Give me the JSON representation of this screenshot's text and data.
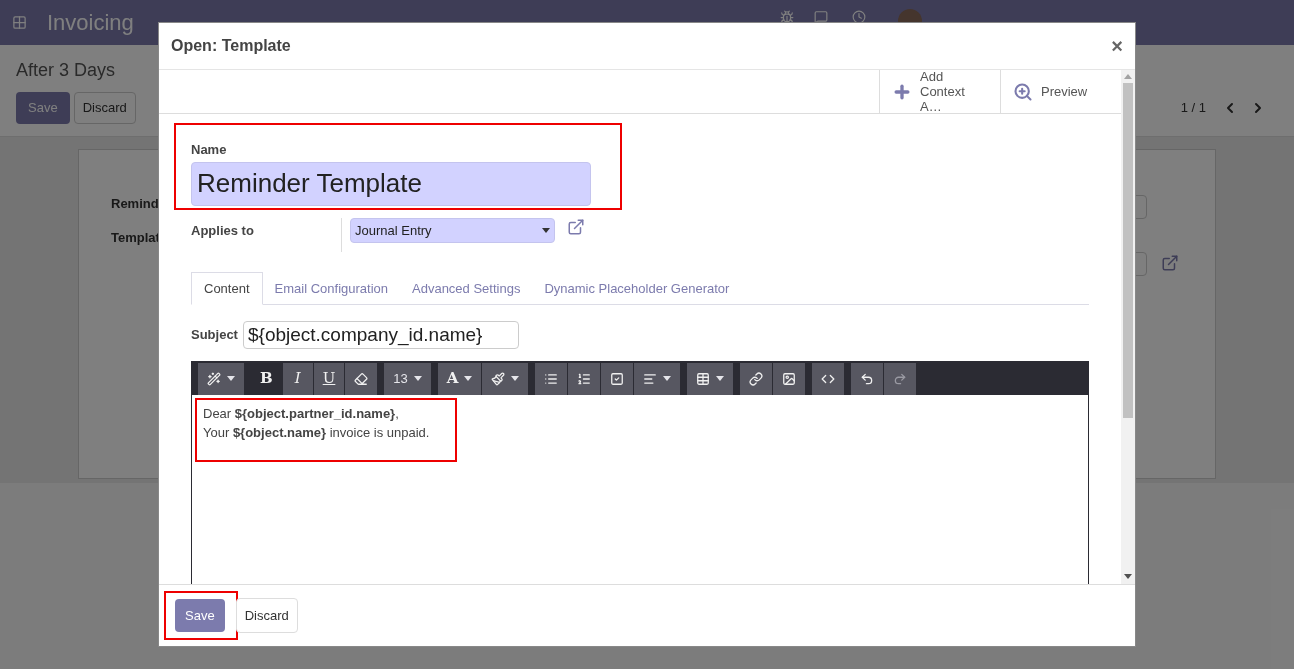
{
  "app": {
    "title": "Invoicing"
  },
  "record": {
    "breadcrumb": "After 3 Days",
    "buttons": [
      "Save",
      "Discard"
    ],
    "pager": "1 / 1",
    "labels": [
      "Remind",
      "Templat"
    ]
  },
  "dialog": {
    "title": "Open: Template",
    "close": "×",
    "actions": [
      {
        "kind": "add",
        "label": "Add\nContext A…"
      },
      {
        "kind": "preview",
        "label": "Preview"
      }
    ],
    "name_label": "Name",
    "name_value": "Reminder Template",
    "applies_label": "Applies to",
    "applies_value": "Journal Entry",
    "tabs": [
      {
        "label": "Content",
        "selected": true
      },
      {
        "label": "Email Configuration",
        "selected": false
      },
      {
        "label": "Advanced Settings",
        "selected": false
      },
      {
        "label": "Dynamic Placeholder Generator",
        "selected": false
      }
    ],
    "subject_label": "Subject",
    "subject_value": "${object.company_id.name}",
    "toolbar": [
      [
        {
          "kind": "wand",
          "caret": true,
          "active": false
        }
      ],
      [
        {
          "kind": "bold",
          "label": "B",
          "caret": false,
          "active": true
        },
        {
          "kind": "italic",
          "label": "I",
          "caret": false,
          "active": false
        },
        {
          "kind": "underline",
          "label": "U",
          "caret": false,
          "active": false
        },
        {
          "kind": "eraser",
          "caret": false,
          "active": false
        }
      ],
      [
        {
          "kind": "size",
          "label": "13",
          "caret": true,
          "active": false
        }
      ],
      [
        {
          "kind": "color",
          "label": "A",
          "caret": true,
          "active": false
        },
        {
          "kind": "brush",
          "caret": true,
          "active": false
        }
      ],
      [
        {
          "kind": "bullets",
          "caret": false,
          "active": false
        },
        {
          "kind": "numbers",
          "caret": false,
          "active": false
        },
        {
          "kind": "checklist",
          "caret": false,
          "active": false
        },
        {
          "kind": "align",
          "caret": true,
          "active": false
        }
      ],
      [
        {
          "kind": "table",
          "caret": true,
          "active": false
        }
      ],
      [
        {
          "kind": "link",
          "caret": false,
          "active": false
        },
        {
          "kind": "image",
          "caret": false,
          "active": false
        }
      ],
      [
        {
          "kind": "code",
          "caret": false,
          "active": false
        }
      ],
      [
        {
          "kind": "undo",
          "caret": false,
          "active": false
        },
        {
          "kind": "redo",
          "caret": false,
          "active": false
        }
      ]
    ],
    "body": [
      "Dear **${object.partner_id.name}**,",
      "Your **${object.name}** invoice is unpaid."
    ],
    "footer_buttons": [
      {
        "kind": "primary",
        "label": "Save"
      },
      {
        "kind": "secondary",
        "label": "Discard"
      }
    ]
  }
}
